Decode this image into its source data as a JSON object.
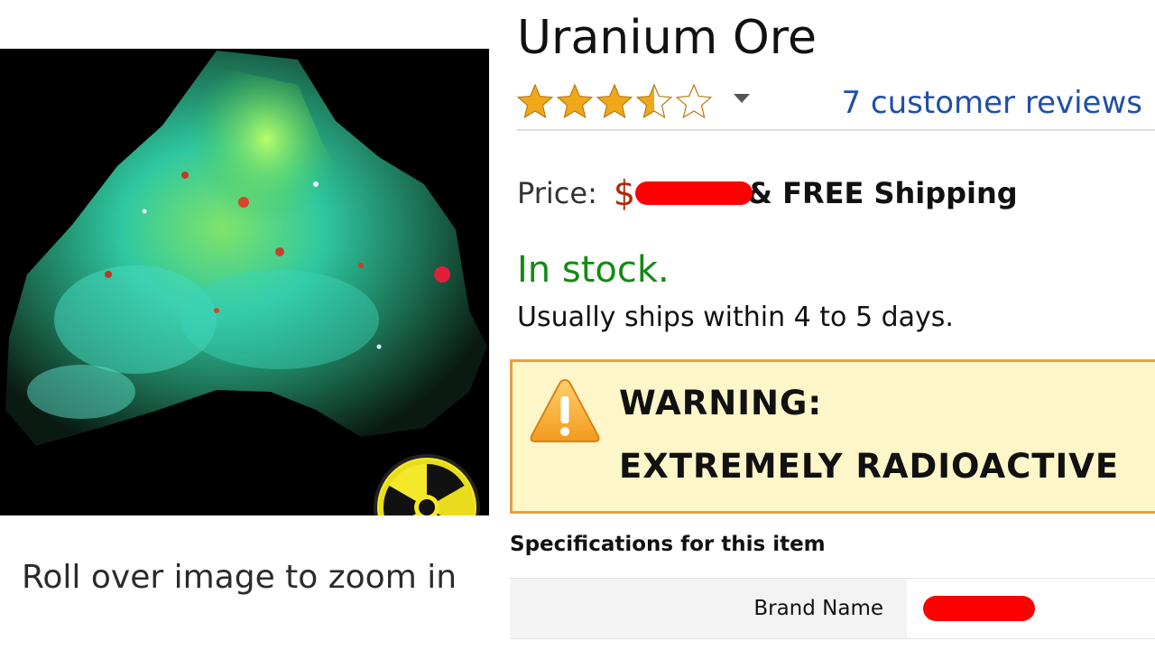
{
  "product": {
    "title": "Uranium Ore",
    "rating_stars": 3.5,
    "rating_max": 5,
    "reviews_link": "7 customer reviews",
    "price_label": "Price:",
    "price_currency": "$",
    "price_redacted": true,
    "shipping": "& FREE Shipping",
    "stock_status": "In stock.",
    "ships_note": "Usually ships within 4 to 5 days."
  },
  "warning": {
    "line1": "WARNING:",
    "line2": "EXTREMELY RADIOACTIVE",
    "icon": "warning-triangle-icon"
  },
  "image": {
    "zoom_hint": "Roll over image to zoom in",
    "badge_icon": "radiation-icon"
  },
  "specs": {
    "heading": "Specifications for this item",
    "rows": [
      {
        "label": "Brand Name",
        "value_redacted": true
      }
    ]
  },
  "colors": {
    "star": "#f0a81a",
    "link": "#1f4fa8",
    "price": "#b12704",
    "in_stock": "#138a13",
    "warning_bg": "#fdf6c8",
    "warning_border": "#e8a13a",
    "redaction": "#ff0000"
  }
}
